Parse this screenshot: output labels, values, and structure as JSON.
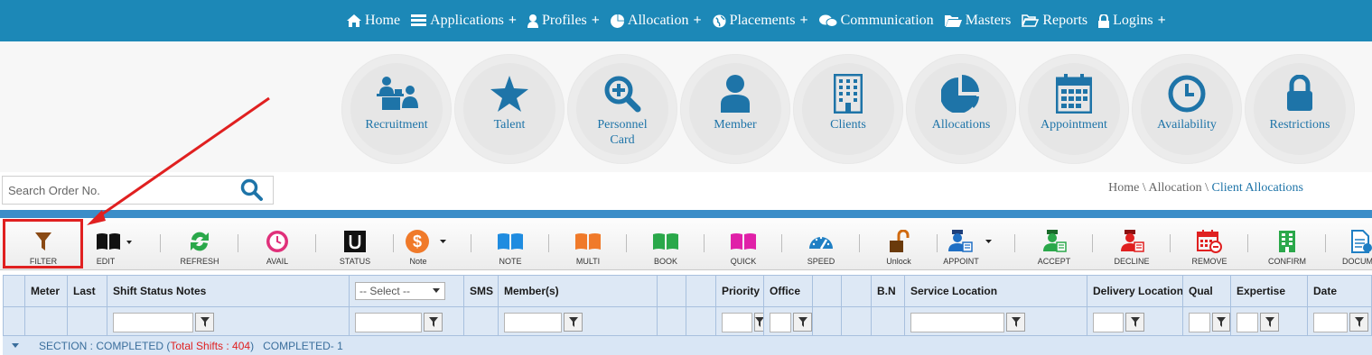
{
  "nav": {
    "items": [
      {
        "label": "Home",
        "icon": "home-icon",
        "plus": ""
      },
      {
        "label": "Applications",
        "icon": "list-icon",
        "plus": "+"
      },
      {
        "label": "Profiles",
        "icon": "user-icon",
        "plus": "+"
      },
      {
        "label": "Allocation",
        "icon": "pie-icon",
        "plus": "+"
      },
      {
        "label": "Placements",
        "icon": "globe-icon",
        "plus": "+"
      },
      {
        "label": "Communication",
        "icon": "chat-icon",
        "plus": ""
      },
      {
        "label": "Masters",
        "icon": "folder-open-icon",
        "plus": ""
      },
      {
        "label": "Reports",
        "icon": "folder-icon",
        "plus": ""
      },
      {
        "label": "Logins",
        "icon": "lock-icon",
        "plus": "+"
      }
    ]
  },
  "tiles": [
    {
      "label": "Recruitment",
      "icon": "recruitment-icon"
    },
    {
      "label": "Talent",
      "icon": "star-icon"
    },
    {
      "label": "Personnel Card",
      "icon": "search-plus-icon"
    },
    {
      "label": "Member",
      "icon": "user-icon"
    },
    {
      "label": "Clients",
      "icon": "building-icon"
    },
    {
      "label": "Allocations",
      "icon": "pie-chart-icon"
    },
    {
      "label": "Appointment",
      "icon": "calendar-icon"
    },
    {
      "label": "Availability",
      "icon": "clock-icon"
    },
    {
      "label": "Restrictions",
      "icon": "lock-icon"
    }
  ],
  "search": {
    "placeholder": "Search Order No."
  },
  "breadcrumb": {
    "home": "Home",
    "section": "Allocation",
    "current": "Client Allocations",
    "sep": " \\ "
  },
  "toolbar": {
    "buttons": [
      {
        "label": "FILTER",
        "icon": "filter-icon"
      },
      {
        "label": "EDIT",
        "icon": "book-icon"
      },
      {
        "label": "REFRESH",
        "icon": "refresh-icon"
      },
      {
        "label": "AVAIL",
        "icon": "clock-icon"
      },
      {
        "label": "STATUS",
        "icon": "status-icon"
      },
      {
        "label": "Note",
        "icon": "dollar-icon"
      },
      {
        "label": "NOTE",
        "icon": "book-blue-icon"
      },
      {
        "label": "MULTI",
        "icon": "book-orange-icon"
      },
      {
        "label": "BOOK",
        "icon": "book-green-icon"
      },
      {
        "label": "QUICK",
        "icon": "book-magenta-icon"
      },
      {
        "label": "SPEED",
        "icon": "speedometer-icon"
      },
      {
        "label": "Unlock",
        "icon": "unlock-icon"
      },
      {
        "label": "APPOINT",
        "icon": "appoint-icon"
      },
      {
        "label": "ACCEPT",
        "icon": "accept-icon"
      },
      {
        "label": "DECLINE",
        "icon": "decline-icon"
      },
      {
        "label": "REMOVE",
        "icon": "remove-icon"
      },
      {
        "label": "CONFIRM",
        "icon": "confirm-icon"
      },
      {
        "label": "DOCUM",
        "icon": "document-icon"
      }
    ]
  },
  "grid": {
    "headers": [
      "Meter",
      "Last",
      "Shift Status Notes",
      "",
      "SMS",
      "Member(s)",
      "",
      "",
      "Priority",
      "Office",
      "",
      "",
      "B.N",
      "Service Location",
      "Delivery Location",
      "Qual",
      "Expertise",
      "Date"
    ],
    "select_placeholder": "-- Select --"
  },
  "group": {
    "prefix": "SECTION : COMPLETED (",
    "total": "Total Shifts : 404",
    "suffix": ")   COMPLETED- 1"
  },
  "colors": {
    "nav_bg": "#1c88b7",
    "accent": "#1e74a8",
    "highlight": "#e02020"
  }
}
